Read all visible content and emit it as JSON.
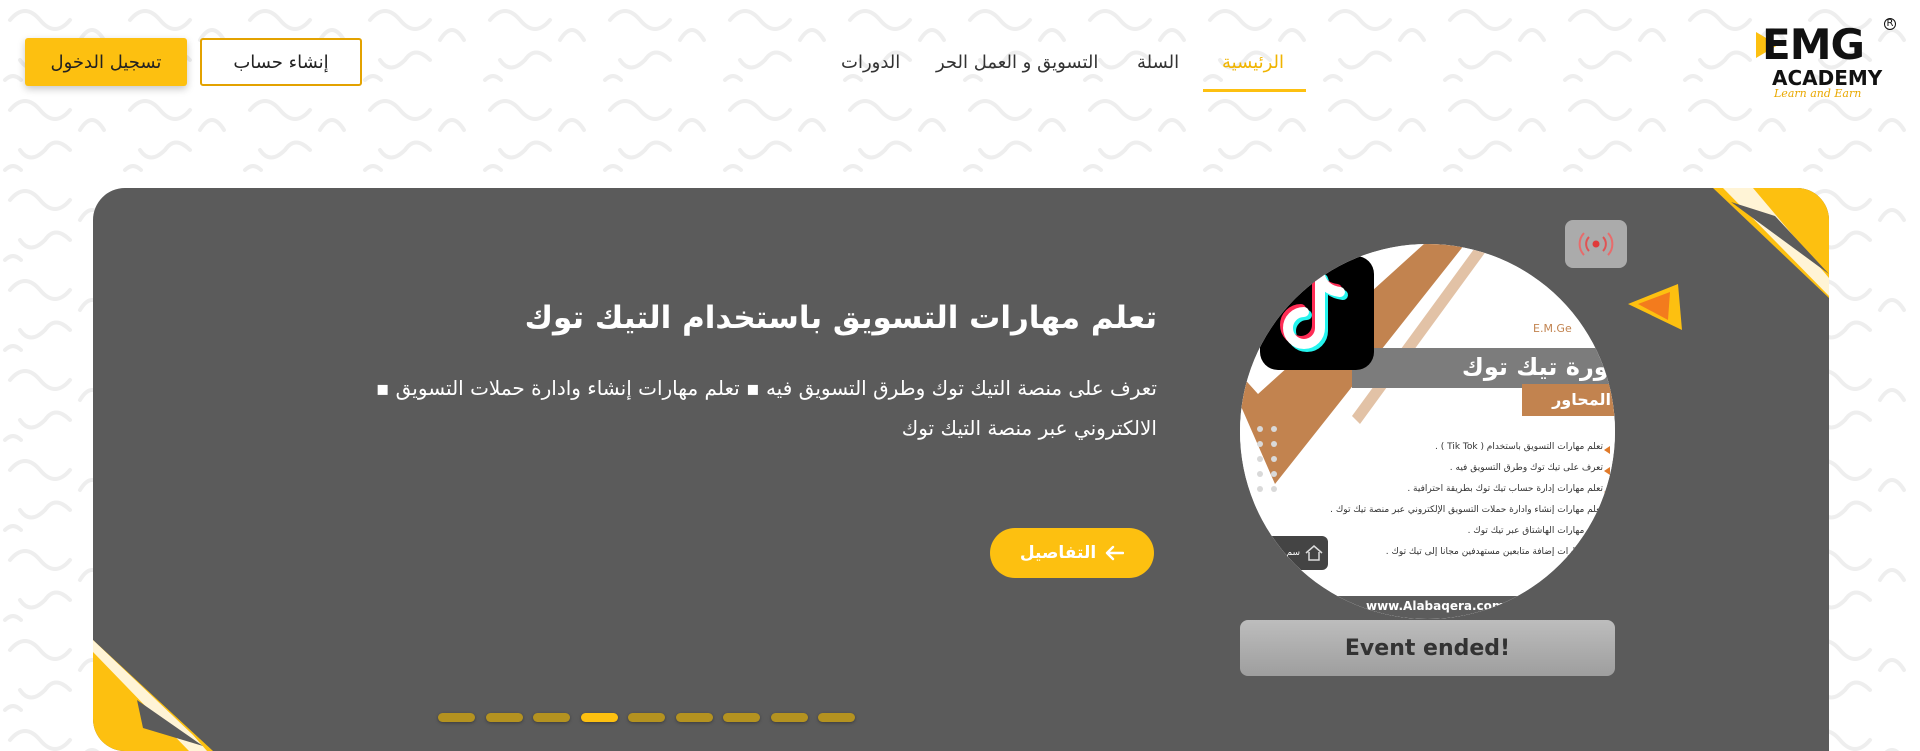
{
  "header": {
    "login_label": "تسجيل الدخول",
    "signup_label": "إنشاء حساب",
    "nav": [
      {
        "label": "الرئيسية",
        "active": true
      },
      {
        "label": "السلة",
        "active": false
      },
      {
        "label": "التسويق و العمل الحر",
        "active": false
      },
      {
        "label": "الدورات",
        "active": false
      }
    ],
    "logo": {
      "brand": "EMG",
      "sub": "ACADEMY",
      "tagline": "Learn and Earn",
      "reg": "R"
    }
  },
  "hero": {
    "title": "تعلم مهارات التسويق باستخدام التيك توك",
    "description": "تعرف على منصة التيك توك وطرق التسويق فيه ▪ تعلم مهارات إنشاء وادارة حملات التسويق ▪ الالكتروني عبر منصة التيك توك",
    "details_label": "التفاصيل",
    "event_status": "Event ended!",
    "slides_total": 9,
    "active_slide": 4
  },
  "course_image": {
    "brand_line": "E.M.Ge",
    "title": "دورة تيك توك",
    "subtitle": "المحاور",
    "points": [
      "تعلم مهارات التسويق باستخدام ( Tik Tok ) .",
      "تعرف على تيك توك وطرق التسويق فيه .",
      "تعلم مهارات إدارة حساب تيك توك بطريقة احترافية .",
      "تعلم مهارات إنشاء وادارة حملات التسويق الإلكتروني عبر منصة تيك توك .",
      "تعلم مهارات الهاشتاق عبر تيك توك .",
      "تعلم مهارات إضافة متابعين مستهدفين مجانا إلى تيك توك ."
    ],
    "website": "www.Alabaqera.com",
    "corner_text": "سم"
  },
  "colors": {
    "accent": "#FDC010",
    "banner": "#5B5B5B",
    "active_nav": "#F0B400",
    "copper": "#C2834F"
  },
  "icons": [
    "broadcast-icon",
    "arrow-left-icon",
    "tiktok-logo-icon",
    "play-triangle-icon"
  ]
}
